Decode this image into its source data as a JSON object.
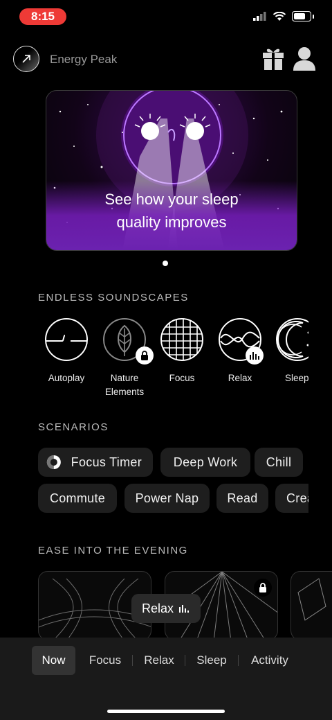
{
  "status_bar": {
    "time": "8:15"
  },
  "header": {
    "title": "Energy Peak"
  },
  "banner": {
    "line1": "See how your sleep",
    "line2": "quality improves"
  },
  "sections": {
    "soundscapes": "ENDLESS SOUNDSCAPES",
    "scenarios": "SCENARIOS",
    "evening": "EASE INTO THE EVENING"
  },
  "soundscapes": [
    {
      "label": "Autoplay"
    },
    {
      "label1": "Nature",
      "label2": "Elements",
      "badge": "lock-icon"
    },
    {
      "label": "Focus"
    },
    {
      "label": "Relax",
      "badge": "equalizer-icon"
    },
    {
      "label": "Sleep"
    }
  ],
  "scenarios": {
    "row1": [
      "Focus Timer",
      "Deep Work",
      "Chill"
    ],
    "row2": [
      "Commute",
      "Power Nap",
      "Read",
      "Create"
    ]
  },
  "now_playing": {
    "label": "Relax"
  },
  "tabs": [
    "Now",
    "Focus",
    "Relax",
    "Sleep",
    "Activity"
  ],
  "colors": {
    "accent_purple": "#6b22b0",
    "status_red": "#ee3a36",
    "chip_bg": "#1e1e1e"
  }
}
